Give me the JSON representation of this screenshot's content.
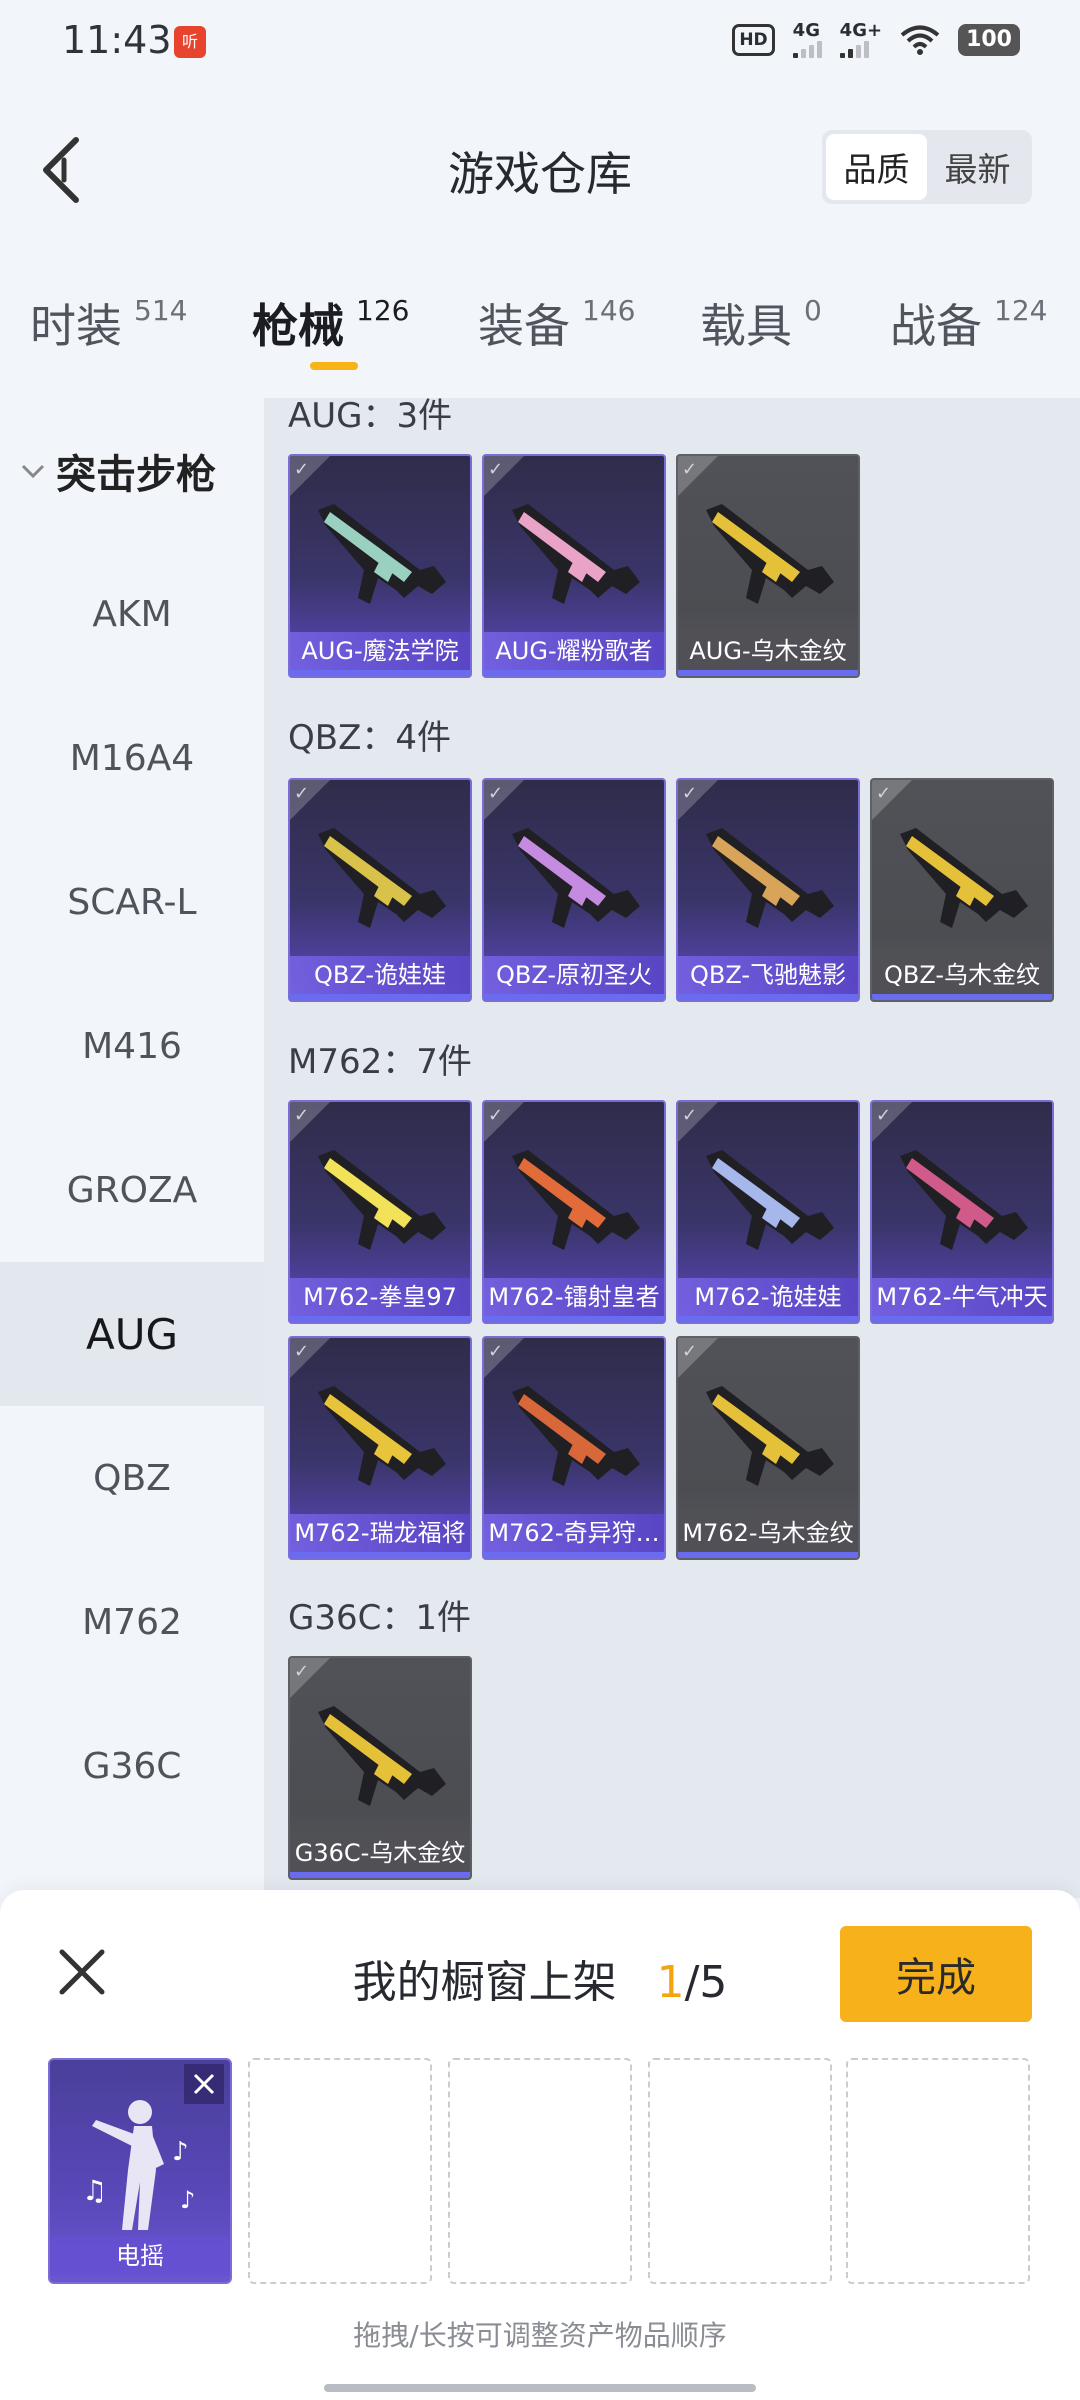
{
  "status": {
    "time": "11:43",
    "notif_app": "听",
    "hd": "HD",
    "net1": "4G",
    "net2": "4G+",
    "battery": "100"
  },
  "header": {
    "title": "游戏仓库",
    "sort_quality": "品质",
    "sort_newest": "最新"
  },
  "tabs": [
    {
      "label": "时装",
      "count": "514"
    },
    {
      "label": "枪械",
      "count": "126"
    },
    {
      "label": "装备",
      "count": "146"
    },
    {
      "label": "载具",
      "count": "0"
    },
    {
      "label": "战备",
      "count": "124"
    }
  ],
  "sidebar": {
    "header": "突击步枪",
    "items": [
      "AKM",
      "M16A4",
      "SCAR-L",
      "M416",
      "GROZA",
      "AUG",
      "QBZ",
      "M762",
      "G36C"
    ],
    "selected": "AUG"
  },
  "sections": [
    {
      "title": "AUG：3件",
      "items": [
        {
          "name": "AUG-魔法学院",
          "style": "purple"
        },
        {
          "name": "AUG-耀粉歌者",
          "style": "purple"
        },
        {
          "name": "AUG-乌木金纹",
          "style": "gray"
        }
      ]
    },
    {
      "title": "QBZ：4件",
      "items": [
        {
          "name": "QBZ-诡娃娃",
          "style": "purple"
        },
        {
          "name": "QBZ-原初圣火",
          "style": "purple"
        },
        {
          "name": "QBZ-飞驰魅影",
          "style": "purple"
        },
        {
          "name": "QBZ-乌木金纹",
          "style": "gray"
        }
      ]
    },
    {
      "title": "M762：7件",
      "items": [
        {
          "name": "M762-拳皇97",
          "style": "purple"
        },
        {
          "name": "M762-镭射皇者",
          "style": "purple"
        },
        {
          "name": "M762-诡娃娃",
          "style": "purple"
        },
        {
          "name": "M762-牛气冲天",
          "style": "purple"
        },
        {
          "name": "M762-瑞龙福将",
          "style": "purple"
        },
        {
          "name": "M762-奇异狩…",
          "style": "purple"
        },
        {
          "name": "M762-乌木金纹",
          "style": "gray"
        }
      ]
    },
    {
      "title": "G36C：1件",
      "items": [
        {
          "name": "G36C-乌木金纹",
          "style": "gray"
        }
      ]
    }
  ],
  "panel": {
    "title": "我的橱窗上架",
    "count_current": "1",
    "count_total": "/5",
    "done_label": "完成",
    "slot_item": "电摇",
    "hint": "拖拽/长按可调整资产物品顺序"
  },
  "colors": {
    "accent": "#f7b21b",
    "rare": "#7b6cd8",
    "underline": "#f8b416"
  }
}
